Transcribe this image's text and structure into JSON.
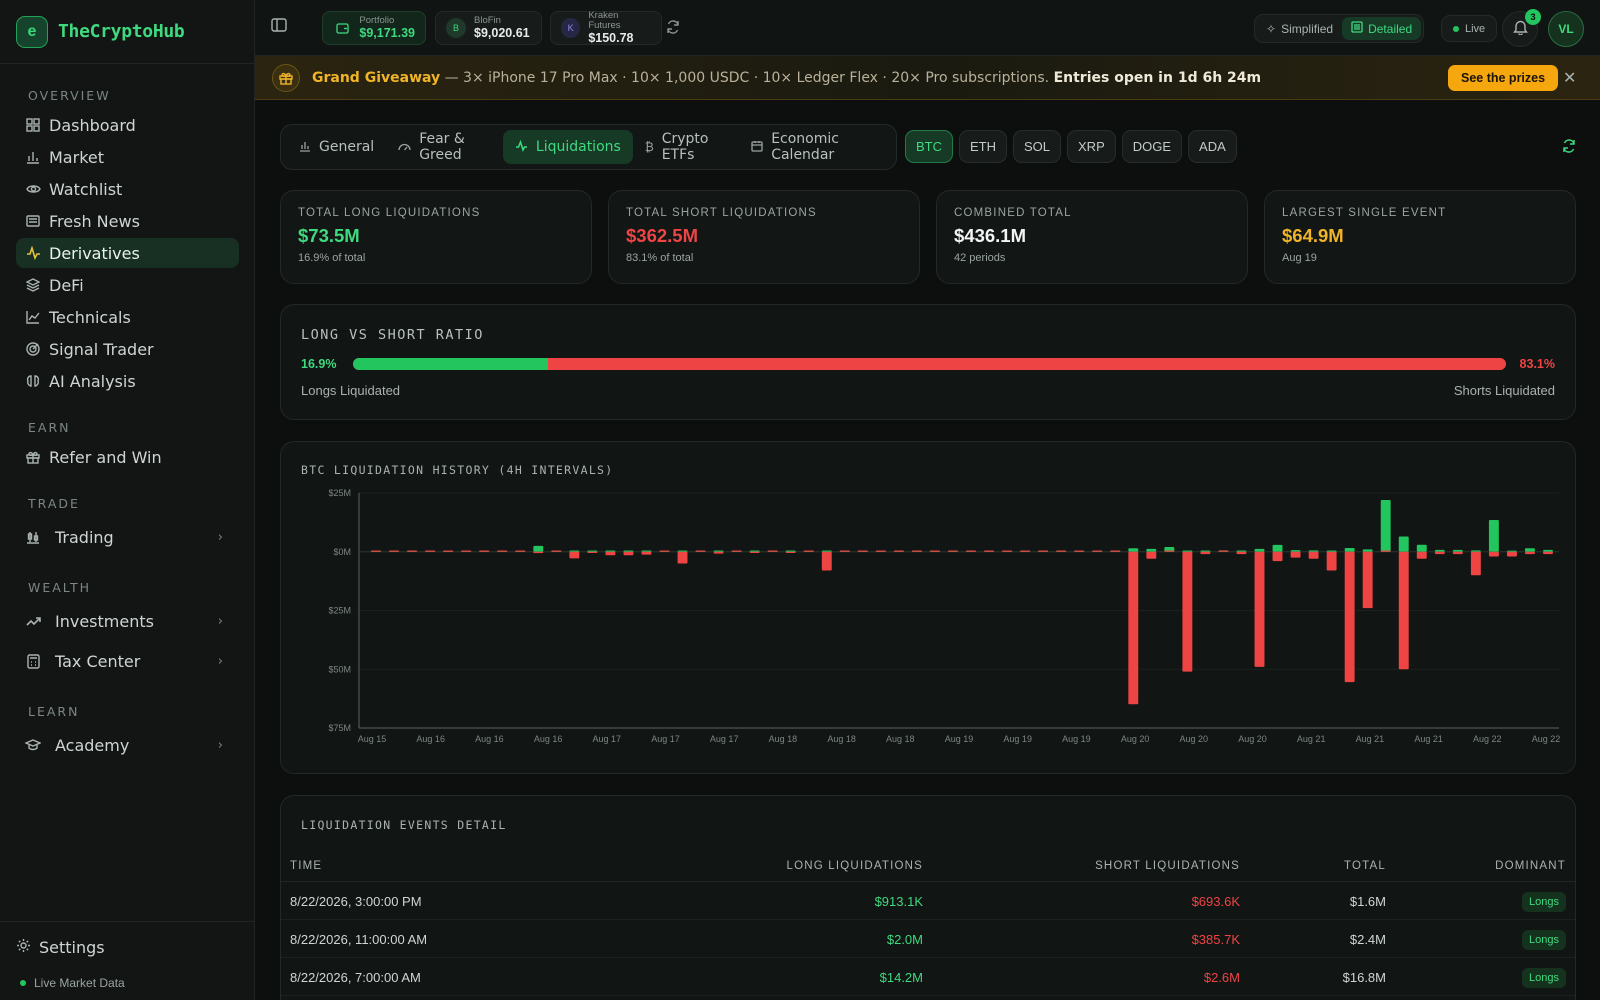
{
  "app": {
    "name": "TheCryptoHub"
  },
  "sidebar": {
    "overview_label": "OVERVIEW",
    "items": [
      {
        "label": "Dashboard"
      },
      {
        "label": "Market"
      },
      {
        "label": "Watchlist"
      },
      {
        "label": "Fresh News"
      },
      {
        "label": "Derivatives"
      },
      {
        "label": "DeFi"
      },
      {
        "label": "Technicals"
      },
      {
        "label": "Signal Trader"
      },
      {
        "label": "AI Analysis"
      }
    ],
    "earn_label": "EARN",
    "refer": "Refer and Win",
    "trade_label": "TRADE",
    "trading": "Trading",
    "wealth_label": "WEALTH",
    "investments": "Investments",
    "tax": "Tax Center",
    "learn_label": "LEARN",
    "academy": "Academy",
    "settings": "Settings",
    "live_data": "Live Market Data"
  },
  "topbar": {
    "accounts": [
      {
        "label": "Portfolio",
        "value": "$9,171.39"
      },
      {
        "label": "BloFin",
        "value": "$9,020.61",
        "initial": "B"
      },
      {
        "label": "Kraken Futures",
        "value": "$150.78",
        "initial": "K"
      }
    ],
    "simplified": "Simplified",
    "detailed": "Detailed",
    "live": "Live",
    "notifications": "3",
    "avatar": "VL"
  },
  "banner": {
    "title": "Grand Giveaway",
    "text": " — 3× iPhone 17 Pro Max · 10× 1,000 USDC · 10× Ledger Flex · 20× Pro subscriptions. ",
    "strong": "Entries open in 1d 6h 24m",
    "button": "See the prizes",
    "close": "✕"
  },
  "tabs": [
    {
      "label": "General"
    },
    {
      "label": "Fear & Greed"
    },
    {
      "label": "Liquidations"
    },
    {
      "label": "Crypto ETFs"
    },
    {
      "label": "Economic Calendar"
    }
  ],
  "coins": [
    "BTC",
    "ETH",
    "SOL",
    "XRP",
    "DOGE",
    "ADA"
  ],
  "stats": [
    {
      "label": "TOTAL LONG LIQUIDATIONS",
      "value": "$73.5M",
      "sub": "16.9% of total"
    },
    {
      "label": "TOTAL SHORT LIQUIDATIONS",
      "value": "$362.5M",
      "sub": "83.1% of total"
    },
    {
      "label": "COMBINED TOTAL",
      "value": "$436.1M",
      "sub": "42 periods"
    },
    {
      "label": "LARGEST SINGLE EVENT",
      "value": "$64.9M",
      "sub": "Aug 19"
    }
  ],
  "ratio": {
    "title": "LONG VS SHORT RATIO",
    "long_pct_label": "16.9%",
    "short_pct_label": "83.1%",
    "long_fraction": 0.169,
    "long_label": "Longs Liquidated",
    "short_label": "Shorts Liquidated"
  },
  "chart_data": {
    "type": "bar",
    "title": "BTC LIQUIDATION HISTORY (4H INTERVALS)",
    "ylabel": "",
    "ylim": [
      -75,
      25
    ],
    "yticks": [
      "$25M",
      "$0M",
      "$25M",
      "$50M",
      "$75M"
    ],
    "ytick_values": [
      25,
      0,
      -25,
      -50,
      -75
    ],
    "xtick_labels": [
      "Aug 15",
      "Aug 16",
      "Aug 16",
      "Aug 16",
      "Aug 17",
      "Aug 17",
      "Aug 17",
      "Aug 18",
      "Aug 18",
      "Aug 18",
      "Aug 19",
      "Aug 19",
      "Aug 19",
      "Aug 20",
      "Aug 20",
      "Aug 20",
      "Aug 21",
      "Aug 21",
      "Aug 21",
      "Aug 22",
      "Aug 22"
    ],
    "series": [
      {
        "name": "Longs",
        "color": "#22c55e",
        "values": [
          0,
          0.1,
          0.1,
          0.1,
          0,
          0,
          0,
          0.1,
          0.1,
          2.5,
          0,
          0,
          0,
          0,
          0,
          0,
          0,
          0,
          0.3,
          0.2,
          0.2,
          0,
          0.1,
          0,
          0,
          0,
          0,
          0.3,
          0.3,
          0.1,
          0,
          0,
          0,
          0,
          0.5,
          0,
          0.2,
          0,
          0.2,
          0.1,
          0.3,
          0,
          1.5,
          1.2,
          2.0,
          0.3,
          0.3,
          0.6,
          0.4,
          1.2,
          2.9,
          0.7,
          0.6,
          0.1,
          1.6,
          1.0,
          22.0,
          6.5,
          3.0,
          0.8,
          0.8,
          0.6,
          13.5,
          0.5,
          1.5,
          0.8
        ]
      },
      {
        "name": "Shorts",
        "color": "#ef4444",
        "values": [
          0,
          0,
          0,
          0,
          0,
          0,
          0,
          0,
          0,
          -0.6,
          0,
          -2.8,
          -0.3,
          -1.5,
          -1.5,
          -1.2,
          0,
          -5.0,
          0,
          -0.8,
          0,
          -0.2,
          0,
          -0.2,
          0,
          -8.0,
          0,
          0,
          0,
          0,
          0,
          0,
          0,
          0,
          0,
          0,
          0,
          0,
          0,
          0,
          0,
          0,
          -64.9,
          -3.0,
          0,
          -51.0,
          -1.0,
          0,
          -1.0,
          -49.0,
          -4.0,
          -2.5,
          -3.0,
          -8.0,
          -55.5,
          -24.0,
          0,
          -50.0,
          -3.0,
          -1.0,
          -1.0,
          -10.0,
          -2.0,
          -2.0,
          -1.0,
          -1.0
        ]
      }
    ]
  },
  "table": {
    "title": "LIQUIDATION EVENTS DETAIL",
    "headers": [
      "TIME",
      "LONG LIQUIDATIONS",
      "SHORT LIQUIDATIONS",
      "TOTAL",
      "DOMINANT"
    ],
    "rows": [
      {
        "time": "8/22/2026, 3:00:00 PM",
        "long": "$913.1K",
        "short": "$693.6K",
        "total": "$1.6M",
        "dominant": "Longs"
      },
      {
        "time": "8/22/2026, 11:00:00 AM",
        "long": "$2.0M",
        "short": "$385.7K",
        "total": "$2.4M",
        "dominant": "Longs"
      },
      {
        "time": "8/22/2026, 7:00:00 AM",
        "long": "$14.2M",
        "short": "$2.6M",
        "total": "$16.8M",
        "dominant": "Longs"
      }
    ]
  },
  "colors": {
    "accent": "#3fd97f",
    "long": "#22c55e",
    "short": "#ef4444",
    "gold": "#f0b429"
  },
  "icons": {
    "logo": "shield-e-icon",
    "gift": "gift-icon",
    "bell": "bell-icon",
    "refresh": "refresh-icon"
  }
}
